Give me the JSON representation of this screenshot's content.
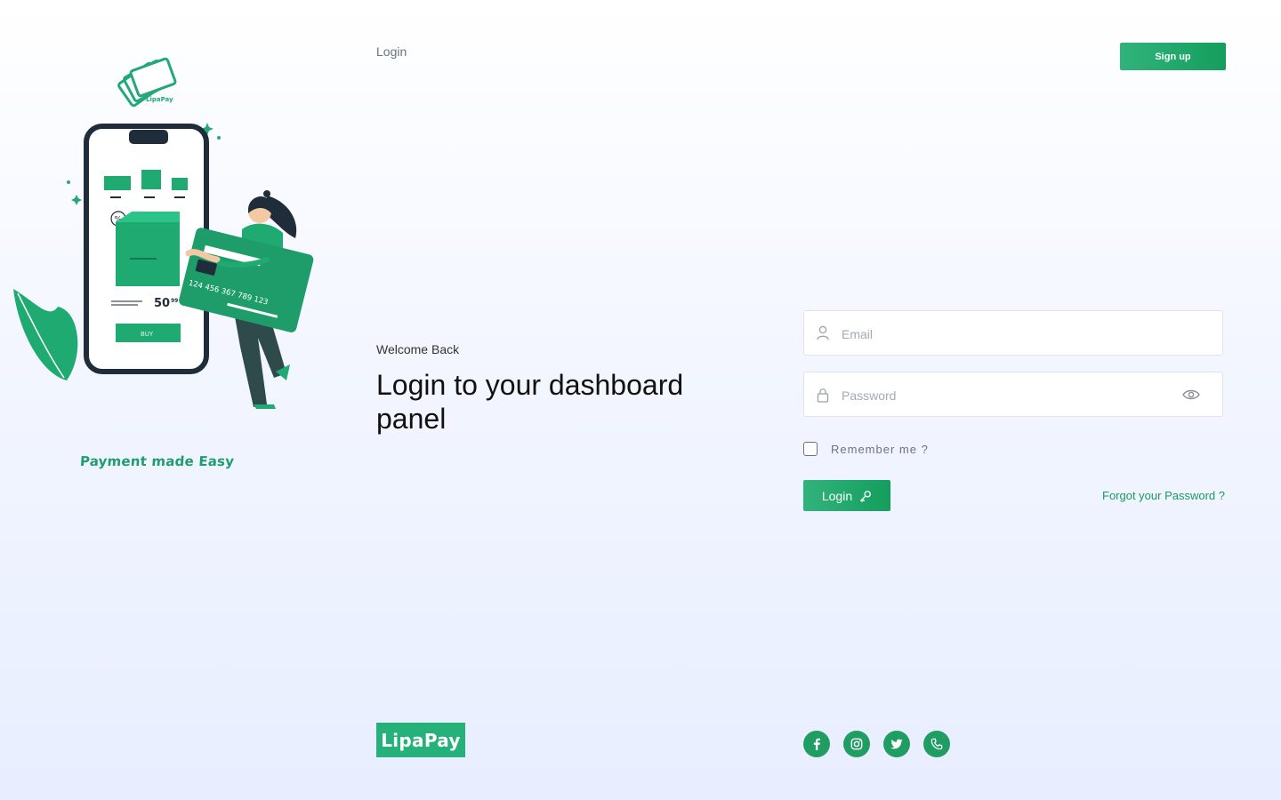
{
  "header": {
    "nav_login": "Login",
    "signup_label": "Sign up"
  },
  "illustration": {
    "logo_text": "LipaPay",
    "card_number": "124 456 367 789 123",
    "price": "50",
    "price_cents": "99",
    "buy_label": "BUY",
    "discount_symbol": "%",
    "tagline": "Payment made Easy"
  },
  "hero": {
    "welcome": "Welcome Back",
    "headline": "Login to your dashboard panel"
  },
  "form": {
    "email_placeholder": "Email",
    "email_value": "",
    "password_placeholder": "Password",
    "password_value": "",
    "remember_label": "Remember me ?",
    "login_label": "Login",
    "forgot_label": "Forgot your Password ?"
  },
  "footer": {
    "brand": "LipaPay",
    "socials": [
      "facebook-icon",
      "instagram-icon",
      "twitter-icon",
      "phone-icon"
    ]
  },
  "colors": {
    "accent": "#1f9d63",
    "accent_light": "#31b37c",
    "text_dark": "#111111",
    "text_muted": "#6b7280"
  }
}
